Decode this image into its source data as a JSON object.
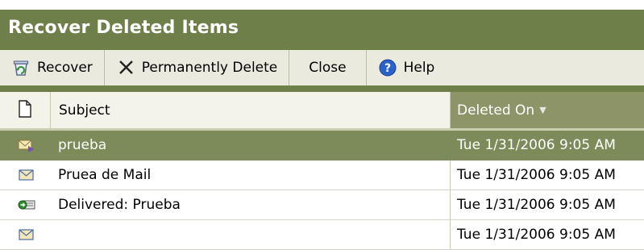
{
  "window": {
    "title": "Recover Deleted Items"
  },
  "toolbar": {
    "recover_label": "Recover",
    "delete_label": "Permanently Delete",
    "close_label": "Close",
    "help_label": "Help"
  },
  "columns": {
    "subject": "Subject",
    "deleted_on": "Deleted On"
  },
  "rows": [
    {
      "icon": "envelope-reply-icon",
      "subject": "prueba",
      "deleted_on": "Tue 1/31/2006 9:05 AM",
      "selected": true
    },
    {
      "icon": "envelope-icon",
      "subject": "Pruea de Mail",
      "deleted_on": "Tue 1/31/2006 9:05 AM",
      "selected": false
    },
    {
      "icon": "delivery-receipt-icon",
      "subject": "Delivered: Prueba",
      "deleted_on": "Tue 1/31/2006 9:05 AM",
      "selected": false
    },
    {
      "icon": "envelope-icon",
      "subject": "",
      "deleted_on": "Tue 1/31/2006 9:05 AM",
      "selected": false
    }
  ],
  "colors": {
    "titlebar": "#6f7f4a",
    "selected_row": "#7d8a5a",
    "sorted_header": "#8c9468"
  }
}
